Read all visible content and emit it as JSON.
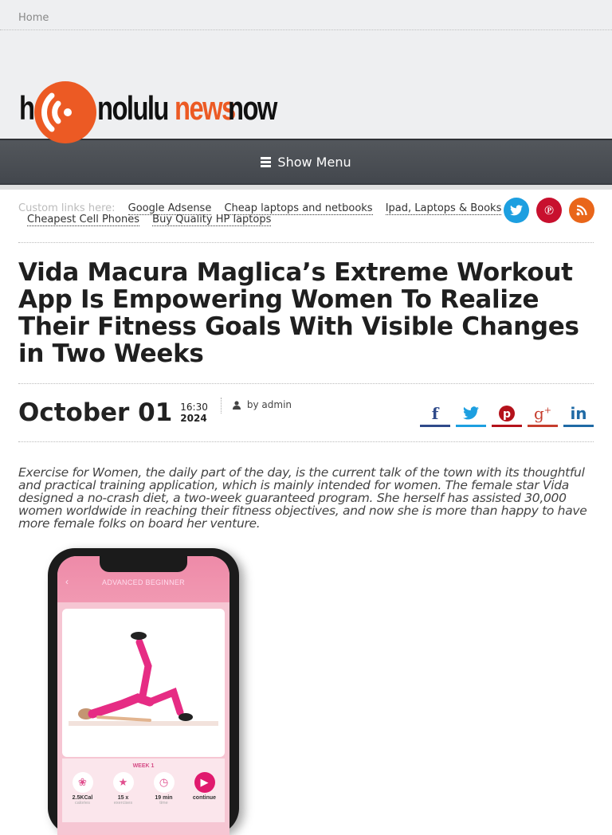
{
  "topbar": {
    "home_label": "Home"
  },
  "logo": {
    "part1": "h",
    "part2": "nolulu",
    "part3": "news",
    "part4": "now",
    "brand_color": "#ec5a24"
  },
  "nav": {
    "show_menu_label": "Show Menu"
  },
  "custom_links": {
    "label": "Custom links here:",
    "items": [
      "Google Adsense",
      "Cheap laptops and netbooks",
      "Ipad, Laptops & Books",
      "Cheapest Cell Phones",
      "Buy Quality HP laptops"
    ]
  },
  "social_follow": [
    {
      "name": "twitter",
      "glyph": "t",
      "color": "#1d9fe0"
    },
    {
      "name": "pinterest",
      "glyph": "p",
      "color": "#c8102e"
    },
    {
      "name": "rss",
      "glyph": "◥",
      "color": "#e9661a"
    }
  ],
  "article": {
    "title": "Vida Macura Maglica’s Extreme Workout App Is Empowering Women To Realize Their Fitness Goals With Visible Changes in Two Weeks",
    "date": "October 01",
    "time": "16:30",
    "year": "2024",
    "author": "by admin",
    "body": "Exercise for Women, the daily part of the day, is the current talk of the town with its thoughtful and practical training application, which is mainly intended for women. The female star Vida designed a no-crash diet, a two-week guaranteed program. She herself has assisted 30,000 women worldwide in reaching their fitness objectives, and now she is more than happy to have more female folks on board her venture."
  },
  "share": [
    {
      "name": "facebook",
      "glyph": "f",
      "color": "#2f4a8a"
    },
    {
      "name": "twitter",
      "glyph": "🐦",
      "color": "#1d9fe0"
    },
    {
      "name": "pinterest",
      "glyph": "P",
      "color": "#b4121b"
    },
    {
      "name": "google-plus",
      "glyph": "g+",
      "color": "#c63d2d"
    },
    {
      "name": "linkedin",
      "glyph": "in",
      "color": "#1f6aa5"
    }
  ],
  "phone_app": {
    "header": "ADVANCED BEGINNER",
    "week": "WEEK 1",
    "stats": [
      {
        "value": "2.5KCal",
        "label": "calories",
        "icon": "❀"
      },
      {
        "value": "15 x",
        "label": "exercises",
        "icon": "★"
      },
      {
        "value": "19 min",
        "label": "time",
        "icon": "◷"
      },
      {
        "value": "continue",
        "label": "",
        "icon": "▶"
      }
    ]
  }
}
